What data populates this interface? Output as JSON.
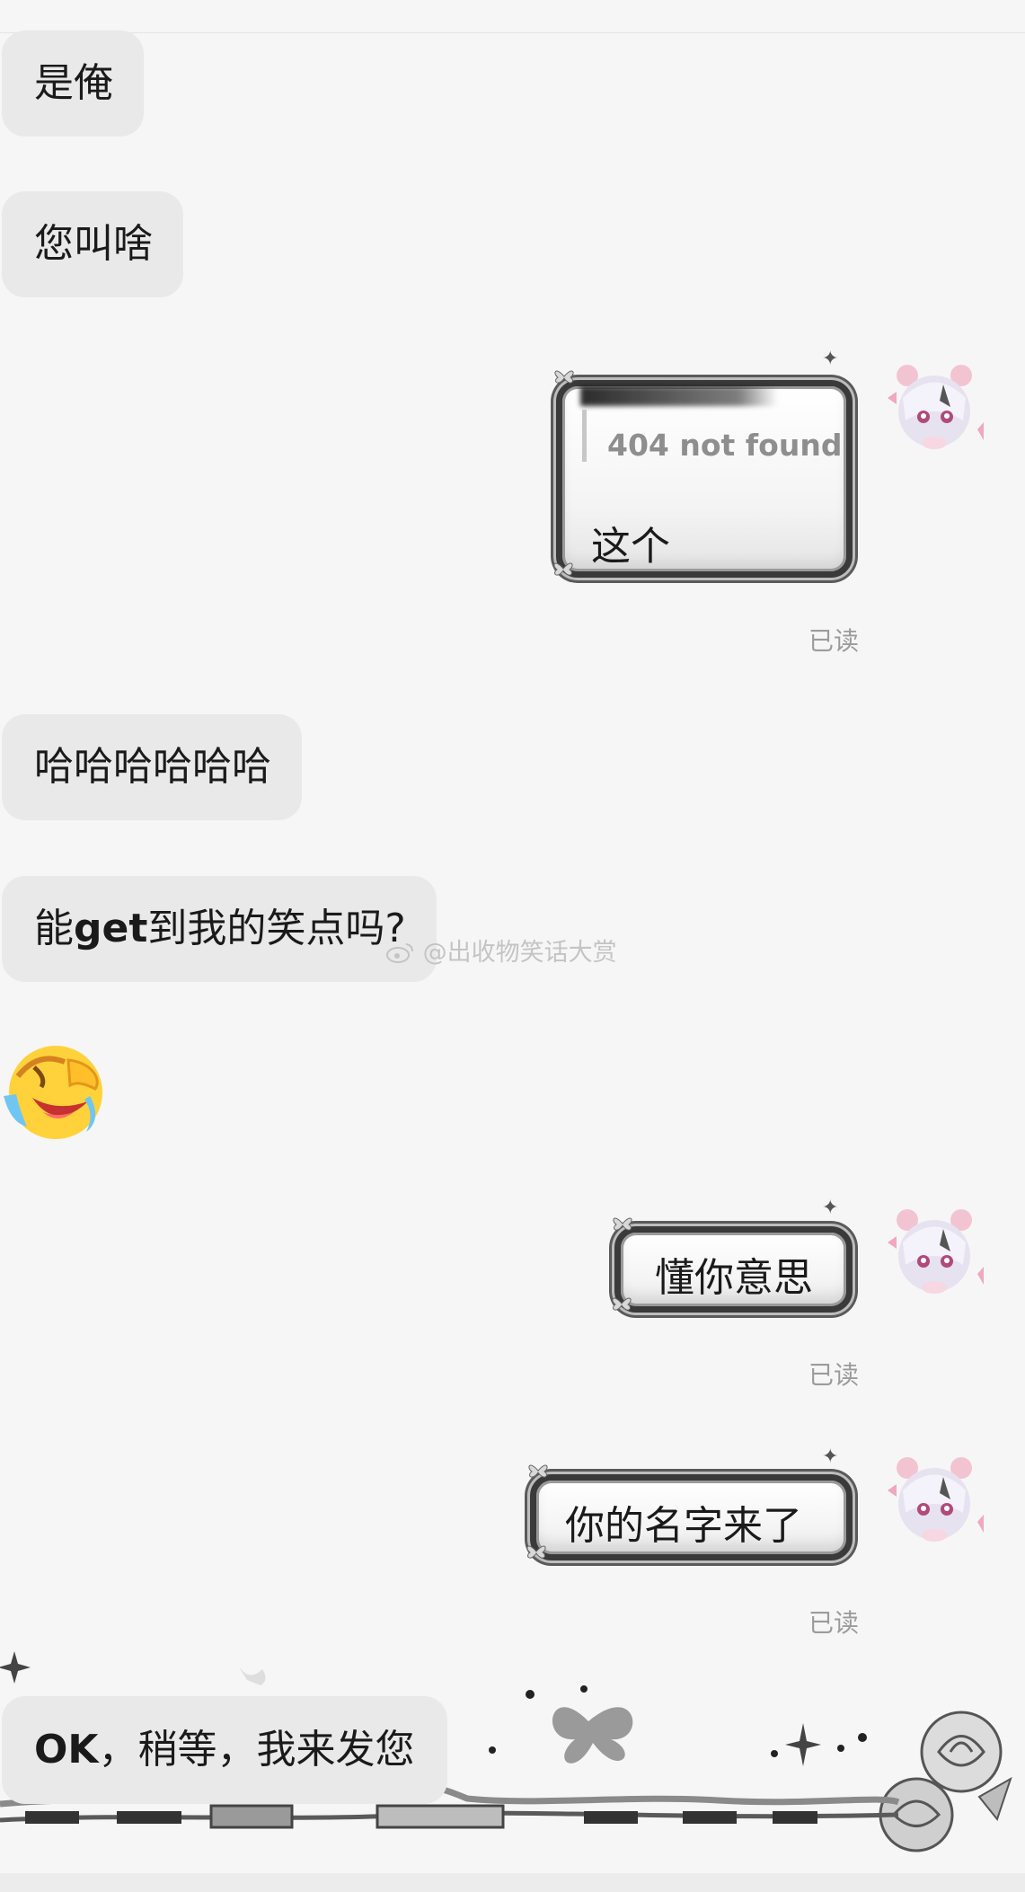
{
  "messages": {
    "m1": "是俺",
    "m2": "您叫啥",
    "m3_quote": "404 not found",
    "m3_text": "这个",
    "m3_status": "已读",
    "m4": "哈哈哈哈哈哈",
    "m5_prefix": "能",
    "m5_bold": "get",
    "m5_suffix": "到我的笑点吗?",
    "m6_emoji": "😭",
    "m7": "懂你意思",
    "m7_status": "已读",
    "m8": "你的名字来了",
    "m8_status": "已读",
    "m9_bold": "OK",
    "m9_rest": "，稍等，我来发您"
  },
  "watermark": "@出收物笑话大赏",
  "colors": {
    "page_bg": "#f6f6f6",
    "incoming_bubble": "#e9e9ea",
    "read_status": "#9b9b9b"
  },
  "icons": [
    "crying-laughing-emoji",
    "anime-avatar-icon",
    "sparkle-icon",
    "butterfly-icon",
    "rose-icon",
    "weibo-icon"
  ]
}
